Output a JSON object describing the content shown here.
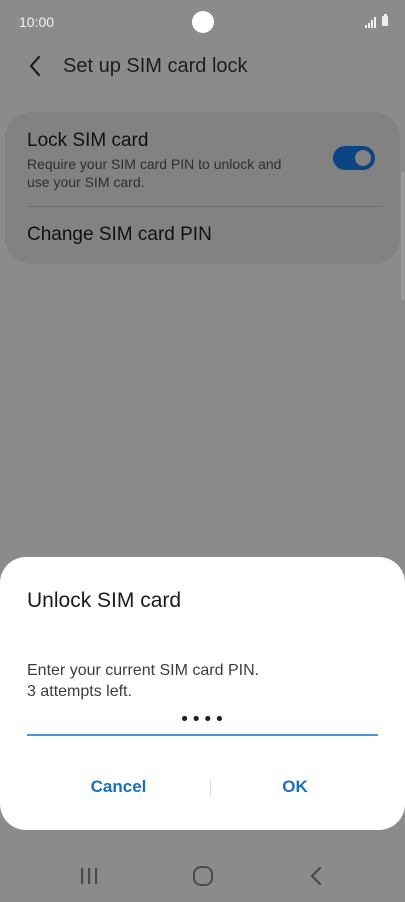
{
  "status_bar": {
    "time": "10:00"
  },
  "header": {
    "title": "Set up SIM card lock"
  },
  "settings": {
    "lock_sim": {
      "title": "Lock SIM card",
      "description": "Require your SIM card PIN to unlock and use your SIM card.",
      "enabled": true
    },
    "change_pin_label": "Change SIM card PIN"
  },
  "dialog": {
    "title": "Unlock SIM card",
    "message_line1": "Enter your current SIM card PIN.",
    "message_line2": "3 attempts left.",
    "pin_value": "••••",
    "cancel_label": "Cancel",
    "ok_label": "OK"
  },
  "colors": {
    "accent": "#1a6fbf",
    "toggle_on": "#0b4584",
    "scrim_background": "#8b8b8b",
    "input_underline": "#4596db"
  },
  "icons": {
    "back": "back-arrow-icon",
    "signal": "signal-icon",
    "battery": "battery-icon",
    "nav_recent": "recent-apps-icon",
    "nav_home": "home-icon",
    "nav_back": "nav-back-icon"
  }
}
